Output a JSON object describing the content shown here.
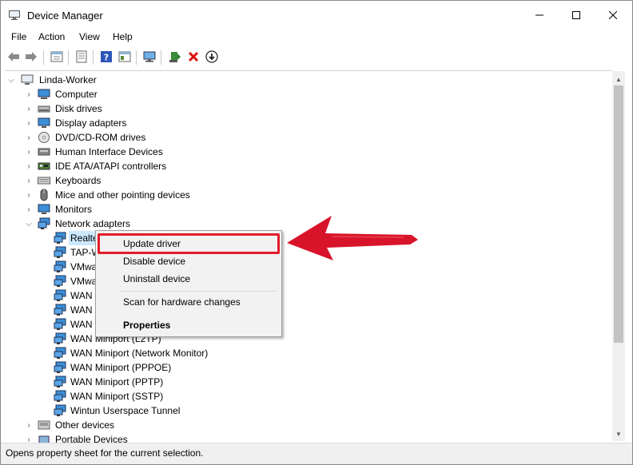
{
  "window": {
    "title": "Device Manager",
    "controls": {
      "minimize": "—",
      "maximize": "☐",
      "close": "✕"
    }
  },
  "menubar": [
    "File",
    "Action",
    "View",
    "Help"
  ],
  "toolbar": {
    "icons": [
      "back-icon",
      "forward-icon",
      "properties-icon",
      "list-icon",
      "help-icon",
      "view-icon",
      "monitor-icon",
      "add-driver-icon",
      "uninstall-icon",
      "download-icon"
    ]
  },
  "tree": {
    "root": "Linda-Worker",
    "categories": [
      {
        "label": "Computer",
        "icon": "computer-icon"
      },
      {
        "label": "Disk drives",
        "icon": "disk-icon"
      },
      {
        "label": "Display adapters",
        "icon": "display-icon"
      },
      {
        "label": "DVD/CD-ROM drives",
        "icon": "dvd-icon"
      },
      {
        "label": "Human Interface Devices",
        "icon": "hid-icon"
      },
      {
        "label": "IDE ATA/ATAPI controllers",
        "icon": "ide-icon"
      },
      {
        "label": "Keyboards",
        "icon": "keyboard-icon"
      },
      {
        "label": "Mice and other pointing devices",
        "icon": "mouse-icon"
      },
      {
        "label": "Monitors",
        "icon": "monitor-icon"
      },
      {
        "label": "Network adapters",
        "icon": "network-icon",
        "expanded": true
      }
    ],
    "network_children": [
      "Realte",
      "TAP-W",
      "VMwa",
      "VMwa",
      "WAN",
      "WAN",
      "WAN",
      "WAN Miniport (L2TP)",
      "WAN Miniport (Network Monitor)",
      "WAN Miniport (PPPOE)",
      "WAN Miniport (PPTP)",
      "WAN Miniport (SSTP)",
      "Wintun Userspace Tunnel"
    ],
    "after": [
      {
        "label": "Other devices",
        "icon": "other-icon"
      },
      {
        "label": "Portable Devices",
        "icon": "portable-icon"
      }
    ]
  },
  "context_menu": {
    "items": [
      "Update driver",
      "Disable device",
      "Uninstall device",
      "Scan for hardware changes",
      "Properties"
    ],
    "highlight_color": "#e21b2a"
  },
  "statusbar": {
    "text": "Opens property sheet for the current selection."
  },
  "colors": {
    "selection": "#cce8ff",
    "annotation": "#e21b2a"
  }
}
